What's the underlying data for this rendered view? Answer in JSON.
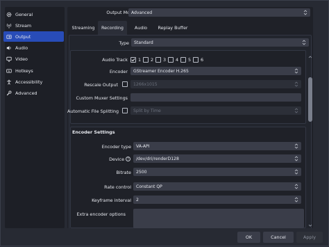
{
  "sidebar": {
    "items": [
      {
        "label": "General",
        "icon": "gear-icon"
      },
      {
        "label": "Stream",
        "icon": "broadcast-icon"
      },
      {
        "label": "Output",
        "icon": "output-icon"
      },
      {
        "label": "Audio",
        "icon": "speaker-icon"
      },
      {
        "label": "Video",
        "icon": "monitor-icon"
      },
      {
        "label": "Hotkeys",
        "icon": "keyboard-icon"
      },
      {
        "label": "Accessibility",
        "icon": "accessibility-icon"
      },
      {
        "label": "Advanced",
        "icon": "wrench-icon"
      }
    ],
    "active_index": 2
  },
  "output_mode": {
    "label": "Output Mode",
    "value": "Advanced"
  },
  "tabs": [
    "Streaming",
    "Recording",
    "Audio",
    "Replay Buffer"
  ],
  "active_tab": "Recording",
  "type": {
    "label": "Type",
    "value": "Standard"
  },
  "recording": {
    "audio_track": {
      "label": "Audio Track",
      "tracks": [
        "1",
        "2",
        "3",
        "4",
        "5",
        "6"
      ],
      "checked": [
        true,
        false,
        false,
        false,
        false,
        false
      ]
    },
    "encoder": {
      "label": "Encoder",
      "value": "GStreamer Encoder H.265"
    },
    "rescale_output": {
      "label": "Rescale Output",
      "checked": false,
      "value": "1266x1015"
    },
    "custom_muxer": {
      "label": "Custom Muxer Settings",
      "value": ""
    },
    "auto_split": {
      "label": "Automatic File Splitting",
      "checked": false,
      "value": "Split by Time"
    }
  },
  "encoder_settings": {
    "title": "Encoder Settings",
    "encoder_type": {
      "label": "Encoder type",
      "value": "VA-API"
    },
    "device": {
      "label": "Device",
      "value": "/dev/dri/renderD128"
    },
    "bitrate": {
      "label": "Bitrate",
      "value": "2500"
    },
    "rate_control": {
      "label": "Rate control",
      "value": "Constant QP"
    },
    "keyframe_interval": {
      "label": "Keyframe interval",
      "value": "2"
    },
    "extra_options": {
      "label": "Extra encoder options",
      "value": ""
    }
  },
  "footer": {
    "ok": "OK",
    "cancel": "Cancel",
    "apply": "Apply"
  },
  "colors": {
    "accent": "#284cb8",
    "window": "#272a33",
    "panel": "#1f2128",
    "field": "#3a3d49"
  }
}
